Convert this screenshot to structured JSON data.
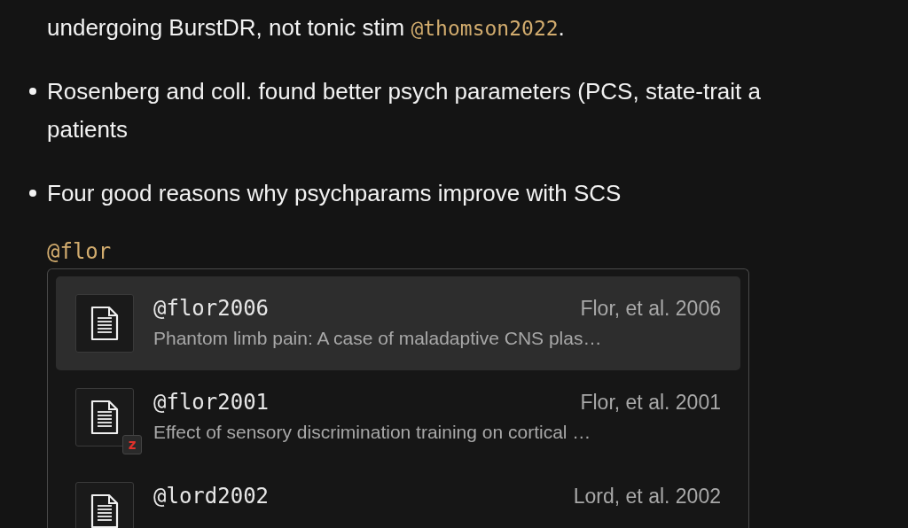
{
  "bullets": [
    {
      "kind": "continuation",
      "lines": [
        "undergoing BurstDR, not tonic stim "
      ],
      "citation": "@thomson2022",
      "tail": "."
    },
    {
      "kind": "item",
      "lines": [
        "Rosenberg and coll. found better psych parameters (PCS, state-trait a",
        "patients"
      ]
    },
    {
      "kind": "item",
      "lines": [
        "Four good reasons why psychparams improve with SCS"
      ]
    }
  ],
  "typed": "@flor",
  "suggestions": [
    {
      "key": "@flor2006",
      "meta": "Flor, et al. 2006",
      "title": "Phantom limb pain: A case of maladaptive CNS plas…",
      "selected": true,
      "zotero": false
    },
    {
      "key": "@flor2001",
      "meta": "Flor, et al. 2001",
      "title": "Effect of sensory discrimination training on cortical …",
      "selected": false,
      "zotero": true,
      "zotero_label": "z"
    },
    {
      "key": "@lord2002",
      "meta": "Lord, et al. 2002",
      "selected": false,
      "zotero": false
    }
  ]
}
